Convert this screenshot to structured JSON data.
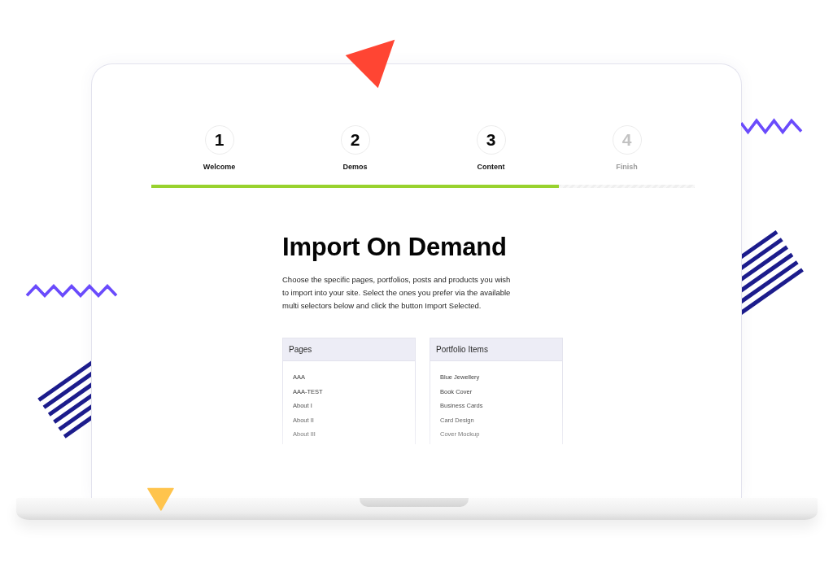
{
  "steps": [
    {
      "number": "1",
      "label": "Welcome",
      "reached": true
    },
    {
      "number": "2",
      "label": "Demos",
      "reached": true
    },
    {
      "number": "3",
      "label": "Content",
      "reached": true
    },
    {
      "number": "4",
      "label": "Finish",
      "reached": false
    }
  ],
  "progress": {
    "level": 0.75
  },
  "heading": "Import On Demand",
  "description": "Choose the specific pages, portfolios, posts and products you wish to import into your site. Select the ones you prefer via the available multi selectors below and click the button Import Selected.",
  "selectors": [
    {
      "title": "Pages",
      "items": [
        "AAA",
        "AAA-TEST",
        "About I",
        "About II",
        "About III"
      ]
    },
    {
      "title": "Portfolio Items",
      "items": [
        "Blue Jewellery",
        "Book Cover",
        "Business Cards",
        "Card Design",
        "Cover Mockup"
      ]
    }
  ]
}
